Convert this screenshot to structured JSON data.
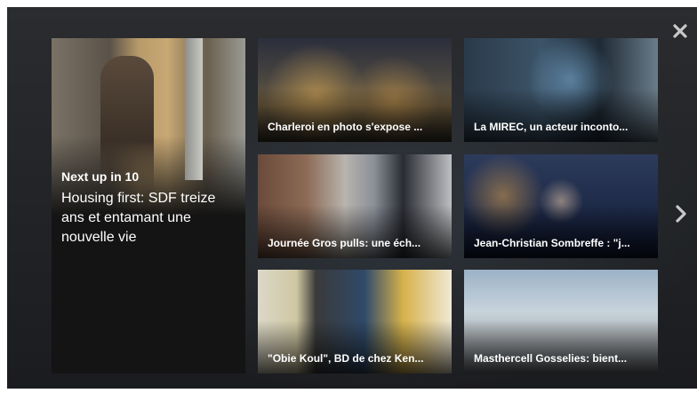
{
  "controls": {
    "close_icon": "close-icon",
    "next_icon": "chevron-right-icon"
  },
  "featured": {
    "next_label": "Next up in 10",
    "title": "Housing first: SDF treize ans et entamant une nouvelle vie"
  },
  "tiles": [
    {
      "caption": "Charleroi en photo s'expose ..."
    },
    {
      "caption": "La MIREC, un acteur inconto..."
    },
    {
      "caption": "Journée Gros pulls: une éch..."
    },
    {
      "caption": "Jean-Christian Sombreffe : \"j..."
    },
    {
      "caption": "\"Obie Koul\", BD de chez Ken..."
    },
    {
      "caption": "Masthercell Gosselies: bient..."
    }
  ]
}
